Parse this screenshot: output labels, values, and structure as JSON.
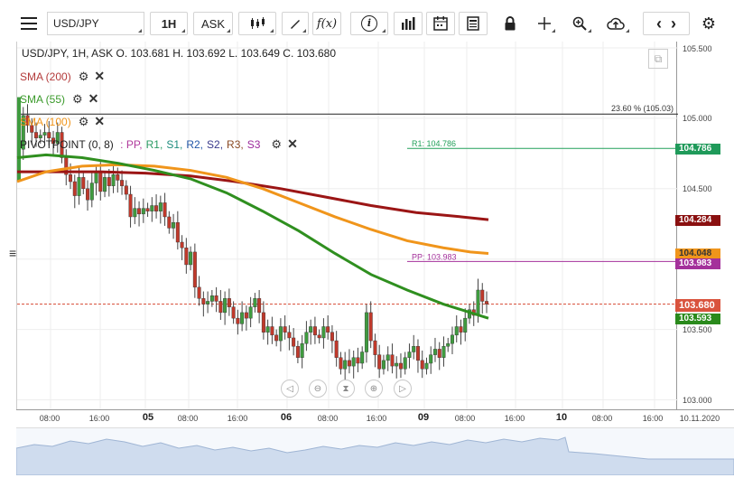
{
  "toolbar": {
    "symbol": "USD/JPY",
    "interval": "1H",
    "price_side": "ASK",
    "fx_label": "f(x)",
    "info_label": "i"
  },
  "legend": {
    "ohlc": "USD/JPY, 1H, ASK   O. 103.681  H. 103.692  L. 103.649  C. 103.680",
    "sma200": "SMA (200)",
    "sma55": "SMA (55)",
    "sma100": "SMA (100)",
    "pivot_title": "PIVOTPOINT (0, 8)",
    "pivot_sep": " : ",
    "pivot_items": [
      {
        "label": "PP,",
        "color": "#b03a9c"
      },
      {
        "label": "R1,",
        "color": "#2a9a63"
      },
      {
        "label": "S1,",
        "color": "#1f8c7e"
      },
      {
        "label": "R2,",
        "color": "#2357a8"
      },
      {
        "label": "S2,",
        "color": "#3a3a8c"
      },
      {
        "label": "R3,",
        "color": "#8a4a24"
      },
      {
        "label": "S3",
        "color": "#9c2a9c"
      }
    ]
  },
  "annotations": {
    "fib": "23.60 % (105.03)",
    "r1": "R1: 104.786",
    "pp": "PP: 103.983"
  },
  "price_axis": {
    "ticks": [
      "105.500",
      "105.000",
      "104.500",
      "103.500",
      "103.000"
    ],
    "badges": {
      "r1": "104.786",
      "sma200": "104.284",
      "sma100": "104.048",
      "pp": "103.983",
      "last": "103.680",
      "sma55": "103.593"
    }
  },
  "time_axis": {
    "labels": [
      {
        "text": "08:00",
        "bold": false
      },
      {
        "text": "16:00",
        "bold": false
      },
      {
        "text": "05",
        "bold": true
      },
      {
        "text": "08:00",
        "bold": false
      },
      {
        "text": "16:00",
        "bold": false
      },
      {
        "text": "06",
        "bold": true
      },
      {
        "text": "08:00",
        "bold": false
      },
      {
        "text": "16:00",
        "bold": false
      },
      {
        "text": "09",
        "bold": true
      },
      {
        "text": "08:00",
        "bold": false
      },
      {
        "text": "16:00",
        "bold": false
      },
      {
        "text": "10",
        "bold": true
      },
      {
        "text": "08:00",
        "bold": false
      },
      {
        "text": "16:00",
        "bold": false
      },
      {
        "text": "10.11.2020",
        "bold": false
      }
    ]
  },
  "colors": {
    "up": "#3f9b3f",
    "down": "#c0392b",
    "sma200": "#9b1515",
    "sma55": "#2f8f1f",
    "sma100": "#f0951b",
    "r1": "#22a05a",
    "pp": "#a4319b",
    "last": "#d9533d"
  }
}
